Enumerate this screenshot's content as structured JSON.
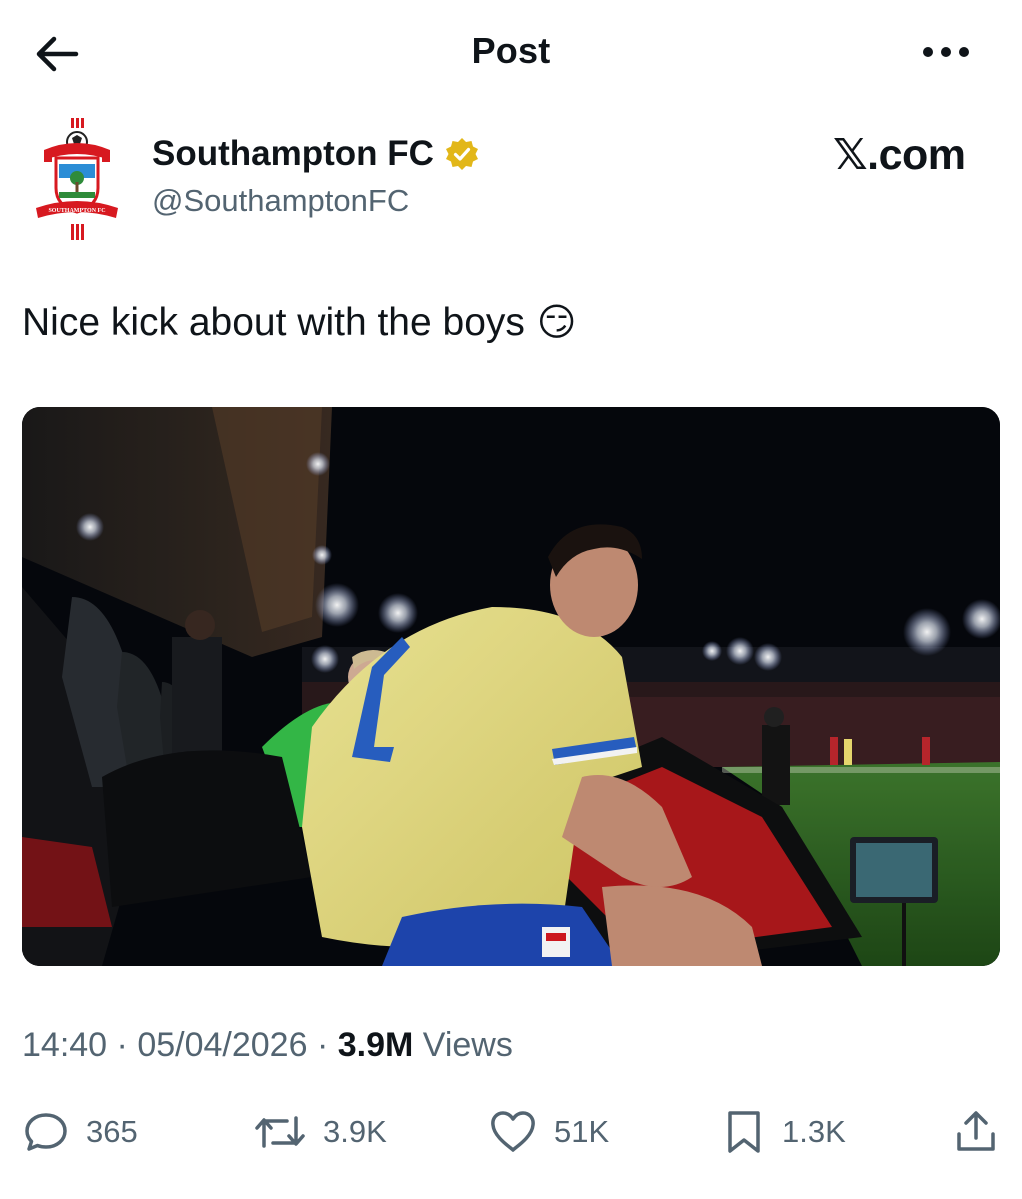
{
  "header": {
    "title": "Post",
    "back_icon": "arrow-left-icon",
    "more_icon": "more-horizontal-icon"
  },
  "author": {
    "name": "Southampton FC",
    "handle": "@SouthamptonFC",
    "verified_icon": "gold-verified-badge-icon",
    "verified_color": "#e2b719"
  },
  "watermark": "𝕏.com",
  "post": {
    "text": "Nice kick about with the boys",
    "emoji": "😏"
  },
  "media": {
    "description_icon": "stadium-photo"
  },
  "meta": {
    "time": "14:40",
    "separator": "·",
    "date": "05/04/2026",
    "views_count": "3.9M",
    "views_label": "Views"
  },
  "actions": {
    "replies": "365",
    "reposts": "3.9K",
    "likes": "51K",
    "bookmarks": "1.3K"
  },
  "colors": {
    "text_primary": "#0f1419",
    "text_secondary": "#536471",
    "background": "#ffffff"
  }
}
